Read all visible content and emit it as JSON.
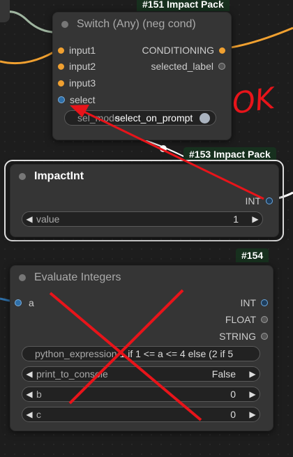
{
  "node151": {
    "badge": "#151 Impact Pack",
    "title": "Switch (Any) (neg cond)",
    "inputs": [
      "input1",
      "input2",
      "input3",
      "select"
    ],
    "outputs": [
      "CONDITIONING",
      "selected_label"
    ],
    "widget_label": "sel_mode",
    "widget_value": "select_on_prompt"
  },
  "node153": {
    "badge": "#153 Impact Pack",
    "title": "ImpactInt",
    "output": "INT",
    "widget_label": "value",
    "widget_value": "1"
  },
  "node154": {
    "badge": "#154",
    "title": "Evaluate Integers",
    "input": "a",
    "outputs": [
      "INT",
      "FLOAT",
      "STRING"
    ],
    "widgets": [
      {
        "label": "python_expression",
        "value": "1 if 1 <= a <= 4 else (2 if 5"
      },
      {
        "label": "print_to_console",
        "value": "False"
      },
      {
        "label": "b",
        "value": "0"
      },
      {
        "label": "c",
        "value": "0"
      }
    ]
  },
  "annotation": {
    "text": "OK",
    "color": "#e8141a"
  }
}
